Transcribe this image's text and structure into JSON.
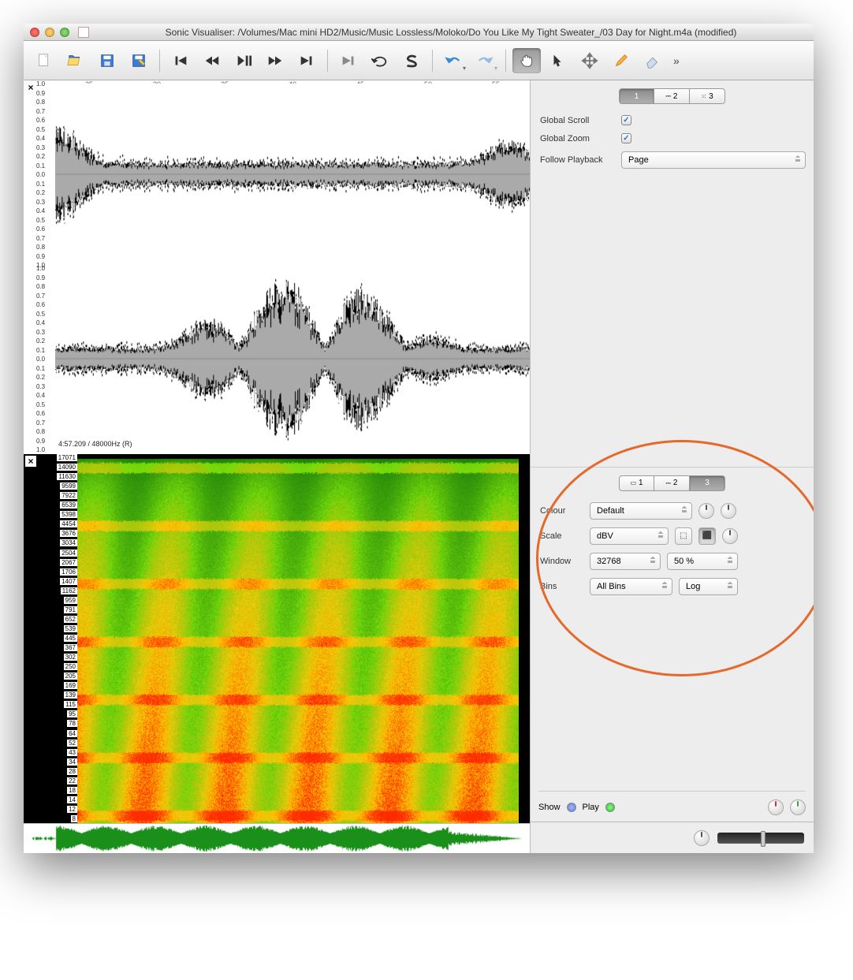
{
  "window": {
    "title": "Sonic Visualiser: /Volumes/Mac mini HD2/Music/Music Lossless/Moloko/Do You Like My Tight Sweater_/03 Day for Night.m4a (modified)"
  },
  "toolbar": {
    "items": [
      "new",
      "open",
      "save",
      "save-as",
      "skip-start",
      "rewind",
      "play-pause",
      "fast-forward",
      "skip-end",
      "play-selection",
      "loop-selection",
      "solo",
      "undo",
      "redo",
      "hand",
      "pointer",
      "move",
      "pencil",
      "eraser",
      "more"
    ]
  },
  "waveform": {
    "time_ticks": [
      "25",
      "30",
      "35",
      "40",
      "45",
      "50",
      "55"
    ],
    "amp_ticks": [
      "1.0",
      "0.9",
      "0.8",
      "0.7",
      "0.6",
      "0.5",
      "0.4",
      "0.3",
      "0.2",
      "0.1",
      "0.0",
      "0.1",
      "0.2",
      "0.3",
      "0.4",
      "0.5",
      "0.6",
      "0.7",
      "0.8",
      "0.9",
      "1.0"
    ],
    "amp_ticks2": [
      "1.0",
      "0.9",
      "0.8",
      "0.7",
      "0.6",
      "0.5",
      "0.4",
      "0.3",
      "0.2",
      "0.1",
      "0.0",
      "0.1",
      "0.2",
      "0.3",
      "0.4",
      "0.5",
      "0.6",
      "0.7",
      "0.8",
      "0.9",
      "1.0"
    ],
    "info": "4:57.209 / 48000Hz (R)"
  },
  "spectrogram": {
    "freq_labels": [
      "17071",
      "14090",
      "11630",
      "9599",
      "7922",
      "6539",
      "5398",
      "4454",
      "3676",
      "3034",
      "2504",
      "2067",
      "1706",
      "1407",
      "1162",
      "959",
      "791",
      "652",
      "539",
      "445",
      "367",
      "302",
      "250",
      "205",
      "169",
      "139",
      "115",
      "95",
      "78",
      "64",
      "52",
      "43",
      "34",
      "28",
      "22",
      "18",
      "14",
      "12",
      "8"
    ]
  },
  "panel1": {
    "tab1": "1",
    "tab2": "2",
    "tab3": "3",
    "global_scroll_label": "Global Scroll",
    "global_zoom_label": "Global Zoom",
    "follow_playback_label": "Follow Playback",
    "follow_playback_value": "Page",
    "global_scroll_checked": true,
    "global_zoom_checked": true
  },
  "panel2": {
    "tab1": "1",
    "tab2": "2",
    "tab3": "3",
    "colour_label": "Colour",
    "colour_value": "Default",
    "scale_label": "Scale",
    "scale_value": "dBV",
    "window_label": "Window",
    "window_size": "32768",
    "window_overlap": "50 %",
    "bins_label": "Bins",
    "bins_value": "All Bins",
    "bins_scale": "Log",
    "show_label": "Show",
    "play_label": "Play"
  }
}
